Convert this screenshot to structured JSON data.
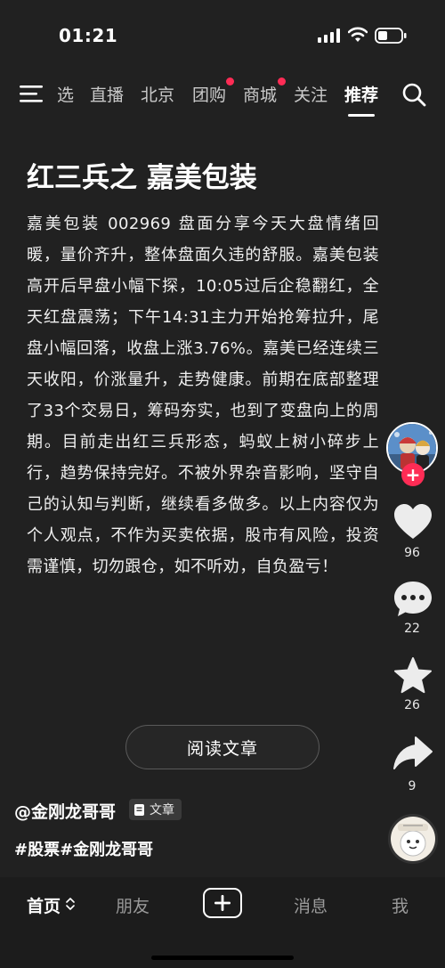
{
  "status_bar": {
    "time": "01:21"
  },
  "top_nav": {
    "tabs": [
      {
        "label": "选",
        "has_dot": false
      },
      {
        "label": "直播",
        "has_dot": false
      },
      {
        "label": "北京",
        "has_dot": false
      },
      {
        "label": "团购",
        "has_dot": true
      },
      {
        "label": "商城",
        "has_dot": true
      },
      {
        "label": "关注",
        "has_dot": false
      },
      {
        "label": "推荐",
        "has_dot": false,
        "active": true
      }
    ],
    "dot_color": "#fe2c55"
  },
  "article": {
    "title": "红三兵之 嘉美包装",
    "body": "嘉美包装 002969 盘面分享今天大盘情绪回暖，量价齐升，整体盘面久违的舒服。嘉美包装高开后早盘小幅下探，10:05过后企稳翻红，全天红盘震荡；下午14:31主力开始抢筹拉升，尾盘小幅回落，收盘上涨3.76%。嘉美已经连续三天收阳，价涨量升，走势健康。前期在底部整理了33个交易日，筹码夯实，也到了变盘向上的周期。目前走出红三兵形态，蚂蚁上树小碎步上行，趋势保持完好。不被外界杂音影响，坚守自己的认知与判断，继续看多做多。以上内容仅为个人观点，不作为买卖依据，股市有风险，投资需谨慎，切勿跟仓，如不听劝，自负盈亏！",
    "read_button": "阅读文章",
    "author": "@金刚龙哥哥",
    "type_badge": "文章",
    "hashtags": "#股票#金刚龙哥哥"
  },
  "actions": {
    "likes": "96",
    "comments": "22",
    "favorites": "26",
    "shares": "9"
  },
  "bottom_bar": {
    "tabs": [
      "首页",
      "朋友",
      "消息",
      "我"
    ]
  },
  "colors": {
    "accent": "#fe2c55",
    "background": "#212121"
  }
}
